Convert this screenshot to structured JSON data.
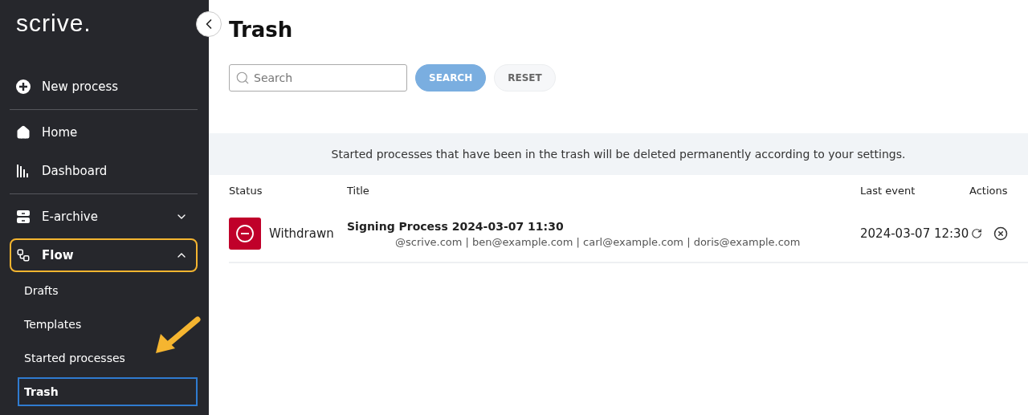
{
  "logo": "scrive.",
  "sidebar": {
    "items": [
      {
        "label": "New process",
        "divider_after": true
      },
      {
        "label": "Home",
        "divider_after": false
      },
      {
        "label": "Dashboard",
        "divider_after": true
      },
      {
        "label": "E-archive",
        "expanded": false,
        "highlighted": false,
        "divider_after": false
      },
      {
        "label": "Flow",
        "expanded": true,
        "highlighted": true,
        "divider_after": false,
        "children": [
          {
            "label": "Drafts",
            "selected": false
          },
          {
            "label": "Templates",
            "selected": false
          },
          {
            "label": "Started processes",
            "selected": false
          },
          {
            "label": "Trash",
            "selected": true
          }
        ]
      }
    ]
  },
  "page": {
    "title": "Trash",
    "search": {
      "placeholder": "Search"
    },
    "buttons": [
      {
        "label": "SEARCH",
        "kind": "primary"
      },
      {
        "label": "RESET",
        "kind": "secondary"
      }
    ],
    "notice": "Started processes that have been in the trash will be deleted permanently according to your settings.",
    "table": {
      "columns": [
        "Status",
        "Title",
        "Last event",
        "Actions"
      ],
      "rows": [
        {
          "status": "Withdrawn",
          "title": "Signing Process 2024-03-07 11:30",
          "participants": "@scrive.com | ben@example.com | carl@example.com | doris@example.com",
          "last_event": "2024-03-07 12:30"
        }
      ]
    }
  }
}
